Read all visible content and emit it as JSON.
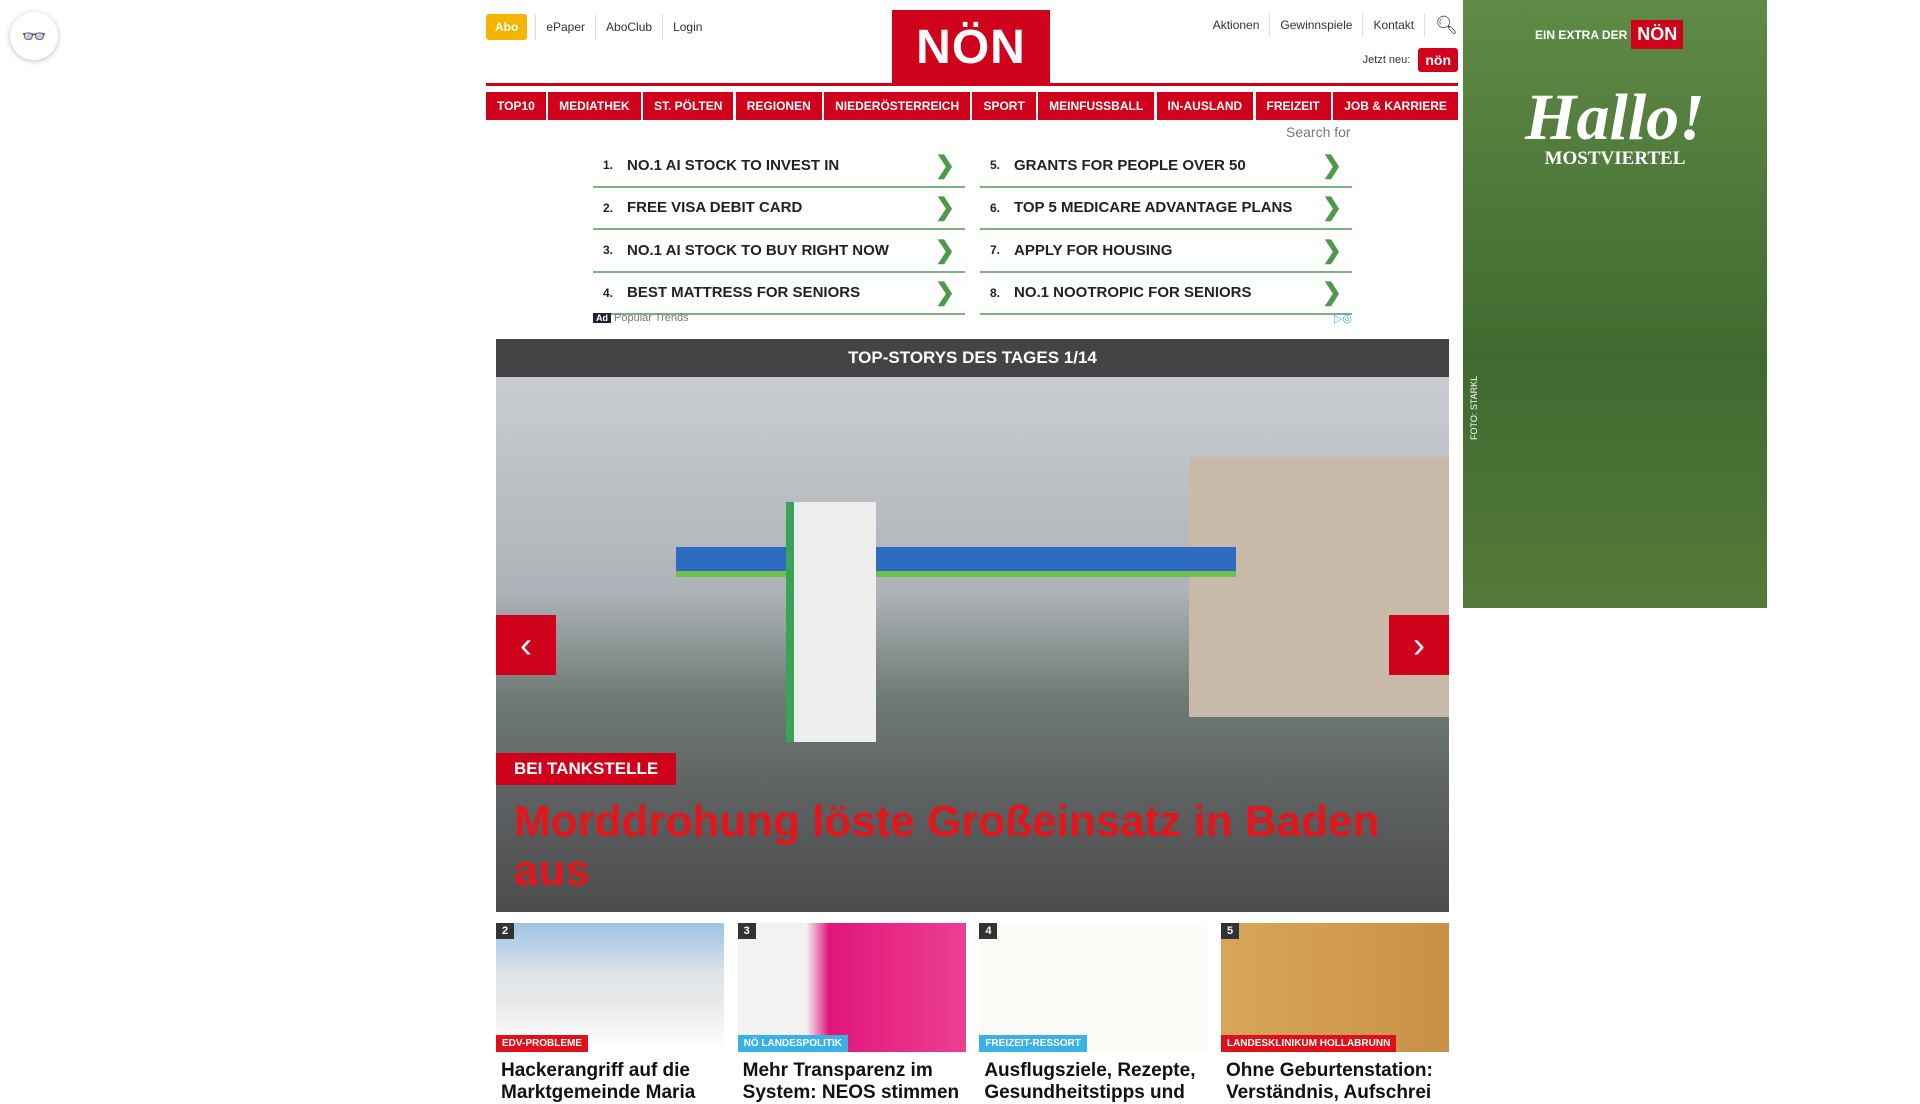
{
  "header": {
    "abo": "Abo",
    "left_links": [
      "ePaper",
      "AboClub",
      "Login"
    ],
    "logo": "NÖN",
    "right_links": [
      "Aktionen",
      "Gewinnspiele",
      "Kontakt"
    ],
    "jetzt_neu": "Jetzt neu:",
    "kleine_non": "nön"
  },
  "nav": [
    "TOP10",
    "MEDIATHEK",
    "ST. PÖLTEN",
    "REGIONEN",
    "NIEDERÖSTERREICH",
    "SPORT",
    "MEINFUSSBALL",
    "IN-AUSLAND",
    "FREIZEIT",
    "JOB & KARRIERE"
  ],
  "search_for": "Search for",
  "ads": [
    {
      "n": "1.",
      "t": "NO.1 AI STOCK TO INVEST IN"
    },
    {
      "n": "5.",
      "t": "GRANTS FOR PEOPLE OVER 50"
    },
    {
      "n": "2.",
      "t": "FREE VISA DEBIT CARD"
    },
    {
      "n": "6.",
      "t": "TOP 5 MEDICARE ADVANTAGE PLANS"
    },
    {
      "n": "3.",
      "t": "NO.1 AI STOCK TO BUY RIGHT NOW"
    },
    {
      "n": "7.",
      "t": "APPLY FOR HOUSING"
    },
    {
      "n": "4.",
      "t": "BEST MATTRESS FOR SENIORS"
    },
    {
      "n": "8.",
      "t": "NO.1 NOOTROPIC FOR SENIORS"
    }
  ],
  "ad_footer": {
    "badge": "Ad",
    "label": "Popular Trends"
  },
  "top_stories": {
    "title": "TOP-STORYS DES TAGES 1/14",
    "kicker": "BEI TANKSTELLE",
    "headline": "Morddrohung löste Großeinsatz in Baden aus"
  },
  "cards": [
    {
      "num": "2",
      "kicker": "EDV-PROBLEME",
      "color": "#e0101a",
      "title": "Hackerangriff auf die Marktgemeinde Maria"
    },
    {
      "num": "3",
      "kicker": "NÖ LANDESPOLITIK",
      "color": "#3ab0e8",
      "title": "Mehr Transparenz im System: NEOS stimmen"
    },
    {
      "num": "4",
      "kicker": "FREIZEIT-RESSORT",
      "color": "#3ab0e8",
      "title": "Ausflugsziele, Rezepte, Gesundheitstipps und"
    },
    {
      "num": "5",
      "kicker": "LANDESKLINIKUM HOLLABRUNN",
      "color": "#e0101a",
      "title": "Ohne Geburtenstation: Verständnis, Aufschrei"
    }
  ],
  "side_ad": {
    "extra": "EIN EXTRA DER",
    "brand": "NÖN",
    "hallo": "Hallo!",
    "region": "MOSTVIERTEL",
    "credit": "FOTO: STARKL"
  }
}
